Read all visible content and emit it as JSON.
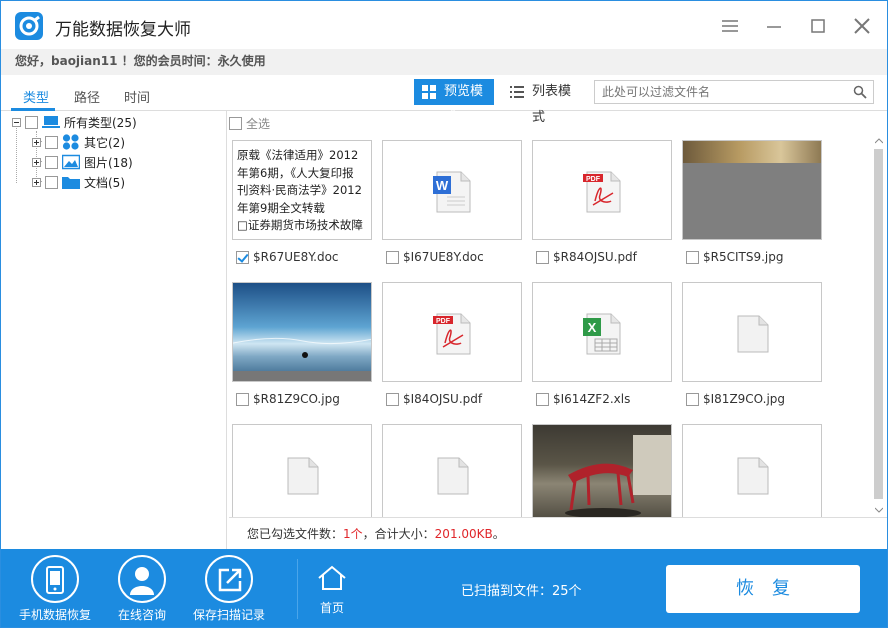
{
  "app": {
    "title": "万能数据恢复大师",
    "brand_color": "#1c8be0",
    "info": "您好，baojian11 ！您的会员时间：永久使用"
  },
  "window_controls": [
    "menu-icon",
    "minimize-icon",
    "maximize-icon",
    "close-icon"
  ],
  "tabs": [
    {
      "label": "类型",
      "active": true
    },
    {
      "label": "路径",
      "active": false
    },
    {
      "label": "时间",
      "active": false
    }
  ],
  "toolbar": {
    "preview_mode": "预览模式",
    "list_mode": "列表模式",
    "filter_placeholder": "此处可以过滤文件名"
  },
  "tree": {
    "root": "所有类型(25)",
    "children": [
      {
        "label": "其它(2)",
        "icon": "other-icon"
      },
      {
        "label": "图片(18)",
        "icon": "image-icon"
      },
      {
        "label": "文档(5)",
        "icon": "folder-icon"
      }
    ]
  },
  "select_all": "全选",
  "files": [
    {
      "name": "$R67UE8Y.doc",
      "kind": "text-preview",
      "checked": true
    },
    {
      "name": "$I67UE8Y.doc",
      "kind": "word",
      "checked": false
    },
    {
      "name": "$R84OJSU.pdf",
      "kind": "pdf",
      "checked": false
    },
    {
      "name": "$R5CITS9.jpg",
      "kind": "photo-gray",
      "checked": false
    },
    {
      "name": "$R81Z9CO.jpg",
      "kind": "photo-sky",
      "checked": false
    },
    {
      "name": "$I84OJSU.pdf",
      "kind": "pdf",
      "checked": false
    },
    {
      "name": "$I614ZF2.xls",
      "kind": "excel",
      "checked": false
    },
    {
      "name": "$I81Z9CO.jpg",
      "kind": "blank",
      "checked": false
    },
    {
      "name": "",
      "kind": "blank",
      "checked": false
    },
    {
      "name": "",
      "kind": "blank",
      "checked": false
    },
    {
      "name": "",
      "kind": "photo-sculpture",
      "checked": false
    },
    {
      "name": "",
      "kind": "blank",
      "checked": false
    }
  ],
  "doc_preview_lines": [
    "原载《法律适用》2012",
    "年第6期，《人大复印报",
    "刊资料·民商法学》2012",
    "年第9期全文转载",
    "□证券期货市场技术故障"
  ],
  "status": {
    "prefix": "您已勾选文件数：",
    "count": "1个",
    "middle": "，合计大小：",
    "size": "201.00KB",
    "suffix": "。"
  },
  "footer": {
    "phone_recover": "手机数据恢复",
    "consult": "在线咨询",
    "save_record": "保存扫描记录",
    "home": "首页",
    "scanned": "已扫描到文件：25个",
    "recover": "恢复"
  }
}
